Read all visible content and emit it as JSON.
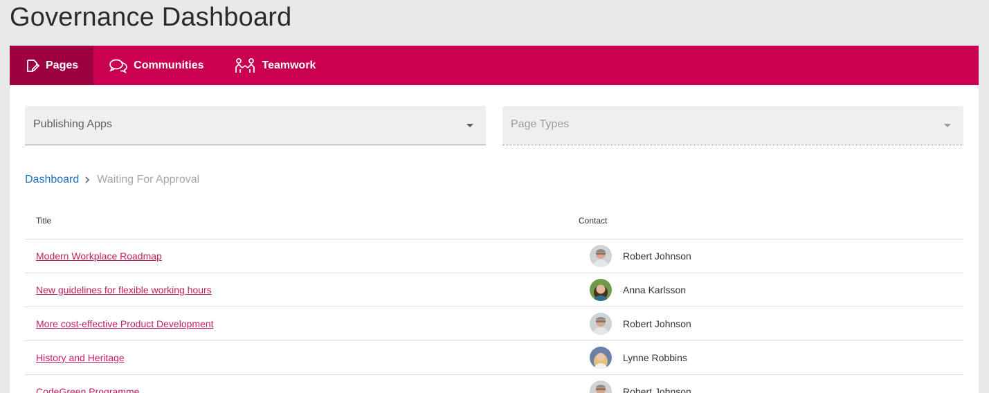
{
  "page": {
    "title": "Governance Dashboard"
  },
  "tabs": [
    {
      "label": "Pages",
      "icon": "page-edit-icon",
      "active": true
    },
    {
      "label": "Communities",
      "icon": "chat-bubbles-icon",
      "active": false
    },
    {
      "label": "Teamwork",
      "icon": "team-people-icon",
      "active": false
    }
  ],
  "filters": {
    "publishing_apps": {
      "label": "Publishing Apps"
    },
    "page_types": {
      "label": "Page Types"
    }
  },
  "breadcrumb": {
    "root": "Dashboard",
    "current": "Waiting For Approval"
  },
  "table": {
    "headers": {
      "title": "Title",
      "contact": "Contact"
    },
    "rows": [
      {
        "title": "Modern Workplace Roadmap",
        "contact": "Robert Johnson"
      },
      {
        "title": "New guidelines for flexible working hours",
        "contact": "Anna Karlsson"
      },
      {
        "title": "More cost-effective Product Development",
        "contact": "Robert Johnson"
      },
      {
        "title": "History and Heritage",
        "contact": "Lynne Robbins"
      },
      {
        "title": "CodeGreen Programme",
        "contact": "Robert Johnson"
      }
    ]
  },
  "colors": {
    "brand": "#c8004f",
    "brand_active": "#9c003e",
    "link": "#c21d5c",
    "breadcrumb_link": "#1a73c7"
  }
}
